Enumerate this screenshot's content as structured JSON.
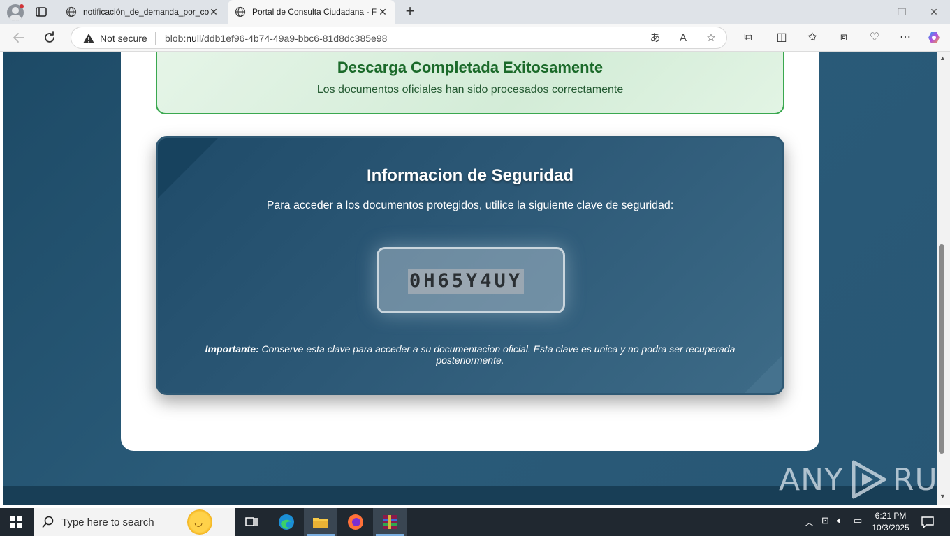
{
  "browser": {
    "tabs": [
      {
        "label": "notificación_de_demanda_por_co",
        "active": false
      },
      {
        "label": "Portal de Consulta Ciudadana - F",
        "active": true
      }
    ],
    "address": {
      "security_label": "Not secure",
      "url_scheme": "blob:",
      "url_host": "null",
      "url_path": "/ddb1ef96-4b74-49a9-bbc6-81d8dc385e98"
    }
  },
  "page": {
    "success": {
      "title": "Descarga Completada Exitosamente",
      "subtitle": "Los documentos oficiales han sido procesados correctamente"
    },
    "security": {
      "title": "Informacion de Seguridad",
      "instructions": "Para acceder a los documentos protegidos, utilice la siguiente clave de seguridad:",
      "key": "0H65Y4UY",
      "note_label": "Importante:",
      "note_text": " Conserve esta clave para acceder a su documentacion oficial. Esta clave es unica y no podra ser recuperada posteriormente."
    },
    "watermark": {
      "left": "ANY",
      "right": "RUN"
    }
  },
  "taskbar": {
    "search_placeholder": "Type here to search",
    "time": "6:21 PM",
    "date": "10/3/2025"
  },
  "colors": {
    "success_border": "#3aa84f",
    "success_title": "#1b6a2a",
    "security_bg": "#2c5876",
    "page_bg": "#1d4a66"
  }
}
